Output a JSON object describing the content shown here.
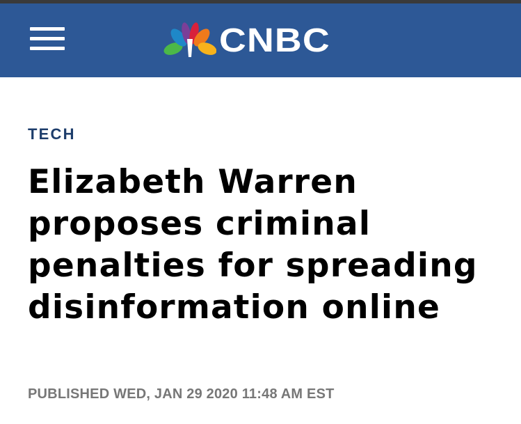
{
  "header": {
    "logo_text": "CNBC",
    "menu_icon": "hamburger-menu-icon",
    "logo_icon": "peacock-icon",
    "background_color": "#2d5896"
  },
  "article": {
    "section": "TECH",
    "headline": "Elizabeth Warren proposes criminal penalties for spreading disinformation online",
    "published": "PUBLISHED WED, JAN 29 2020 11:48 AM EST"
  },
  "colors": {
    "section_label": "#1d3d6b",
    "headline": "#000000",
    "published": "#777777",
    "peacock": [
      "#f7b21b",
      "#ef7a1c",
      "#d8213b",
      "#7b3f98",
      "#1e88c8",
      "#4cb848"
    ]
  }
}
